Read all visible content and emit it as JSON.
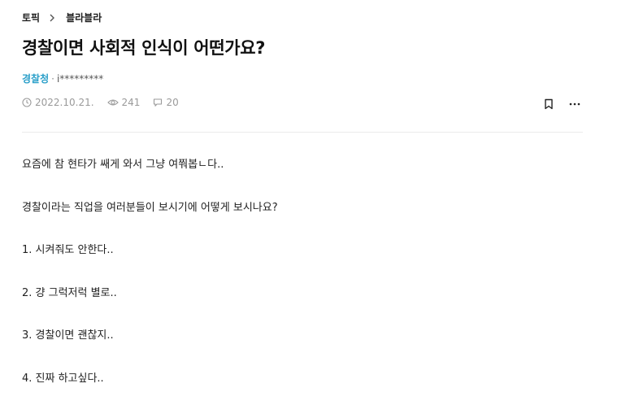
{
  "breadcrumb": {
    "root": "토픽",
    "current": "블라블라"
  },
  "post": {
    "title": "경찰이면 사회적 인식이 어떤가요?",
    "author": {
      "company": "경찰청",
      "separator": "·",
      "user": "i*********"
    },
    "meta": {
      "date": "2022.10.21.",
      "views": "241",
      "comments": "20"
    },
    "body": [
      "요즘에 참 현타가 쌔게 와서 그냥 여쭤봅ㄴ다..",
      "경찰이라는 직업을 여러분들이 보시기에 어떻게 보시나요?",
      "1. 시켜줘도 안한다..",
      "2. 걍 그럭저럭 별로..",
      "3. 경찰이면 괜찮지..",
      "4. 진짜 하고싶다.."
    ]
  },
  "icons": {
    "breadcrumb_sep": "chevron-right-icon",
    "date": "clock-icon",
    "views": "eye-icon",
    "comments": "speech-bubble-icon",
    "bookmark": "bookmark-icon",
    "more": "more-horizontal-icon"
  },
  "colors": {
    "company": "#2a9fc9",
    "meta": "#9a9a9a",
    "divider": "#ebebeb"
  }
}
